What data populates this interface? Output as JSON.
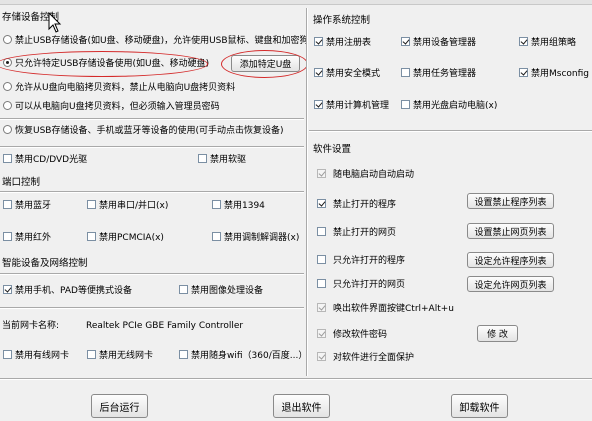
{
  "menu_strip": {
    "visible": true
  },
  "usb": {
    "title": "存储设备控制",
    "options": [
      {
        "label": "禁止USB存储设备(如U盘、移动硬盘)，允许使用USB鼠标、键盘和加密狗",
        "selected": false
      },
      {
        "label": "只允许特定USB存储设备使用(如U盘、移动硬盘)",
        "selected": true
      },
      {
        "label": "允许从U盘向电脑拷贝资料，禁止从电脑向U盘拷贝资料",
        "selected": false
      },
      {
        "label": "可以从电脑向U盘拷贝资料，但必须输入管理员密码",
        "selected": false
      },
      {
        "label": "恢复USB存储设备、手机或蓝牙等设备的使用(可手动点击恢复设备)",
        "selected": false
      }
    ],
    "add_usb_button": "添加特定U盘",
    "checks": [
      {
        "label": "禁用CD/DVD光驱",
        "checked": false
      },
      {
        "label": "禁用软驱",
        "checked": false
      }
    ]
  },
  "ports": {
    "title": "端口控制",
    "checks": [
      {
        "label": "禁用蓝牙",
        "checked": false
      },
      {
        "label": "禁用串口/并口(x)",
        "checked": false
      },
      {
        "label": "禁用1394",
        "checked": false
      },
      {
        "label": "禁用红外",
        "checked": false
      },
      {
        "label": "禁用PCMCIA(x)",
        "checked": false
      },
      {
        "label": "禁用调制解调器(x)",
        "checked": false
      }
    ]
  },
  "smart": {
    "title": "智能设备及网络控制",
    "checks": [
      {
        "label": "禁用手机、PAD等便携式设备",
        "checked": true
      },
      {
        "label": "禁用图像处理设备",
        "checked": false
      }
    ],
    "nic_label": "当前网卡名称:",
    "nic_name": "Realtek PCIe GBE Family Controller",
    "net_checks": [
      {
        "label": "禁用有线网卡",
        "checked": false
      },
      {
        "label": "禁用无线网卡",
        "checked": false
      },
      {
        "label": "禁用随身wifi（360/百度...）",
        "checked": false
      }
    ]
  },
  "os": {
    "title": "操作系统控制",
    "checks": [
      {
        "label": "禁用注册表",
        "checked": true
      },
      {
        "label": "禁用设备管理器",
        "checked": true
      },
      {
        "label": "禁用组策略",
        "checked": true
      },
      {
        "label": "禁用安全模式",
        "checked": true
      },
      {
        "label": "禁用任务管理器",
        "checked": false
      },
      {
        "label": "禁用Msconfig",
        "checked": true
      },
      {
        "label": "禁用计算机管理",
        "checked": true
      },
      {
        "label": "禁用光盘启动电脑(x)",
        "checked": false
      }
    ]
  },
  "software": {
    "title": "软件设置",
    "items": [
      {
        "label": "随电脑启动自动启动",
        "checked": true,
        "disabled": true
      },
      {
        "label": "禁止打开的程序",
        "checked": true,
        "disabled": false,
        "button": "设置禁止程序列表"
      },
      {
        "label": "禁止打开的网页",
        "checked": false,
        "disabled": false,
        "button": "设置禁止网页列表"
      },
      {
        "label": "只允许打开的程序",
        "checked": false,
        "disabled": false,
        "button": "设定允许程序列表"
      },
      {
        "label": "只允许打开的网页",
        "checked": false,
        "disabled": false,
        "button": "设定允许网页列表"
      },
      {
        "label": "唤出软件界面按键Ctrl+Alt+u",
        "checked": true,
        "disabled": true
      },
      {
        "label": "修改软件密码",
        "checked": true,
        "disabled": true,
        "button": "修 改"
      },
      {
        "label": "对软件进行全面保护",
        "checked": true,
        "disabled": true
      }
    ]
  },
  "footer": {
    "background_run": "后台运行",
    "exit": "退出软件",
    "uninstall": "卸载软件"
  },
  "colors": {
    "highlight_ellipse": "#d42a2a",
    "window_bg": "#f0f0f0"
  }
}
